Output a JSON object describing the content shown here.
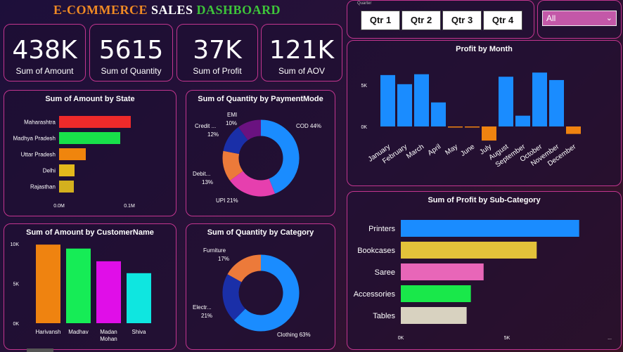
{
  "header": {
    "title_part1": "E-COMMERCE",
    "title_part2": "SALES",
    "title_part3": "DASHBOARD"
  },
  "kpis": [
    {
      "value": "438K",
      "label": "Sum of Amount"
    },
    {
      "value": "5615",
      "label": "Sum of Quantity"
    },
    {
      "value": "37K",
      "label": "Sum of Profit"
    },
    {
      "value": "121K",
      "label": "Sum of AOV"
    }
  ],
  "slicer": {
    "label": "Quarter",
    "buttons": [
      "Qtr 1",
      "Qtr 2",
      "Qtr 3",
      "Qtr 4"
    ]
  },
  "dropdown": {
    "selected": "All"
  },
  "colors": {
    "border": "#c2358f",
    "blue": "#1a8cff"
  },
  "chart_data": [
    {
      "id": "state",
      "type": "bar",
      "orientation": "horizontal",
      "title": "Sum of Amount by State",
      "categories": [
        "Maharashtra",
        "Madhya Pradesh",
        "Uttar Pradesh",
        "Delhi",
        "Rajasthan"
      ],
      "values": [
        102000,
        87000,
        38000,
        22000,
        21000
      ],
      "colors": [
        "#ee2a2a",
        "#18e04a",
        "#f0850d",
        "#e3b91c",
        "#d4b01e"
      ],
      "xticks": [
        "0.0M",
        "0.1M"
      ],
      "xlim": [
        0,
        100000
      ]
    },
    {
      "id": "payment",
      "type": "pie",
      "donut": true,
      "title": "Sum of Quantity by PaymentMode",
      "categories": [
        "COD",
        "UPI",
        "Debit...",
        "Credit ...",
        "EMI"
      ],
      "values": [
        44,
        21,
        13,
        12,
        10
      ],
      "labels": [
        "COD 44%",
        "UPI 21%",
        "13%",
        "12%",
        "10%"
      ],
      "colors": [
        "#1a8cff",
        "#e63fae",
        "#ec7a3a",
        "#1a2fa8",
        "#6a1280"
      ]
    },
    {
      "id": "customer",
      "type": "bar",
      "orientation": "vertical",
      "title": "Sum of Amount by CustomerName",
      "categories": [
        "Harivansh",
        "Madhav",
        "Madan Mohan",
        "Shiva"
      ],
      "values": [
        9900,
        9400,
        7800,
        6300
      ],
      "colors": [
        "#ef8310",
        "#16ec56",
        "#e00ee8",
        "#0fe6e0"
      ],
      "yticks": [
        "0K",
        "5K",
        "10K"
      ],
      "ylim": [
        0,
        10000
      ]
    },
    {
      "id": "category",
      "type": "pie",
      "donut": true,
      "title": "Sum of Quantity by Category",
      "categories": [
        "Clothing",
        "Electr...",
        "Furniture"
      ],
      "values": [
        63,
        21,
        17
      ],
      "labels": [
        "Clothing 63%",
        "21%",
        "17%"
      ],
      "colors": [
        "#1a8cff",
        "#1a2fa8",
        "#ec7a3a"
      ]
    },
    {
      "id": "month",
      "type": "bar",
      "orientation": "vertical",
      "title": "Profit by Month",
      "categories": [
        "January",
        "February",
        "March",
        "April",
        "May",
        "June",
        "July",
        "August",
        "September",
        "October",
        "November",
        "December"
      ],
      "values": [
        6200,
        5100,
        6300,
        2900,
        -100,
        -100,
        -1700,
        6000,
        1300,
        6500,
        5600,
        -900
      ],
      "colors": [
        "#1a8cff",
        "#1a8cff",
        "#1a8cff",
        "#1a8cff",
        "#ef8310",
        "#ef8310",
        "#ef8310",
        "#1a8cff",
        "#1a8cff",
        "#1a8cff",
        "#1a8cff",
        "#ef8310"
      ],
      "yticks": [
        "0K",
        "5K"
      ],
      "ylim": [
        -2500,
        7200
      ]
    },
    {
      "id": "subcat",
      "type": "bar",
      "orientation": "horizontal",
      "title": "Sum of Profit by Sub-Category",
      "categories": [
        "Printers",
        "Bookcases",
        "Saree",
        "Accessories",
        "Tables"
      ],
      "values": [
        8400,
        6400,
        3900,
        3300,
        3100
      ],
      "colors": [
        "#1a8cff",
        "#e3c23a",
        "#e866b8",
        "#19e84a",
        "#d8d2c0"
      ],
      "xticks": [
        "0K",
        "5K"
      ],
      "xlim": [
        0,
        10000
      ]
    }
  ]
}
